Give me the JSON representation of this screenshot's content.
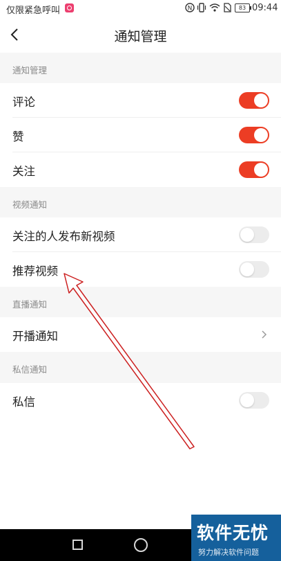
{
  "status_bar": {
    "carrier_text": "仅限紧急呼叫",
    "battery_level": "83",
    "time": "09:44"
  },
  "header": {
    "title": "通知管理"
  },
  "sections": [
    {
      "title": "通知管理",
      "items": [
        {
          "label": "评论",
          "control": "toggle",
          "enabled": true
        },
        {
          "label": "赞",
          "control": "toggle",
          "enabled": true
        },
        {
          "label": "关注",
          "control": "toggle",
          "enabled": true
        }
      ]
    },
    {
      "title": "视频通知",
      "items": [
        {
          "label": "关注的人发布新视频",
          "control": "toggle",
          "enabled": false
        },
        {
          "label": "推荐视频",
          "control": "toggle",
          "enabled": false
        }
      ]
    },
    {
      "title": "直播通知",
      "items": [
        {
          "label": "开播通知",
          "control": "chevron"
        }
      ]
    },
    {
      "title": "私信通知",
      "items": [
        {
          "label": "私信",
          "control": "toggle",
          "enabled": false
        }
      ]
    }
  ],
  "colors": {
    "toggle_on": "#ec3d24",
    "toggle_off": "#ececec",
    "annotation_arrow": "#cc1f1f",
    "watermark_bg": "#15609c"
  },
  "watermark": {
    "main": "软件无忧",
    "sub": "努力解决软件问题"
  },
  "icons": {
    "back": "chevron-left-icon",
    "row_arrow": "chevron-right-icon",
    "nav_recent": "square-icon",
    "nav_home": "circle-icon"
  }
}
